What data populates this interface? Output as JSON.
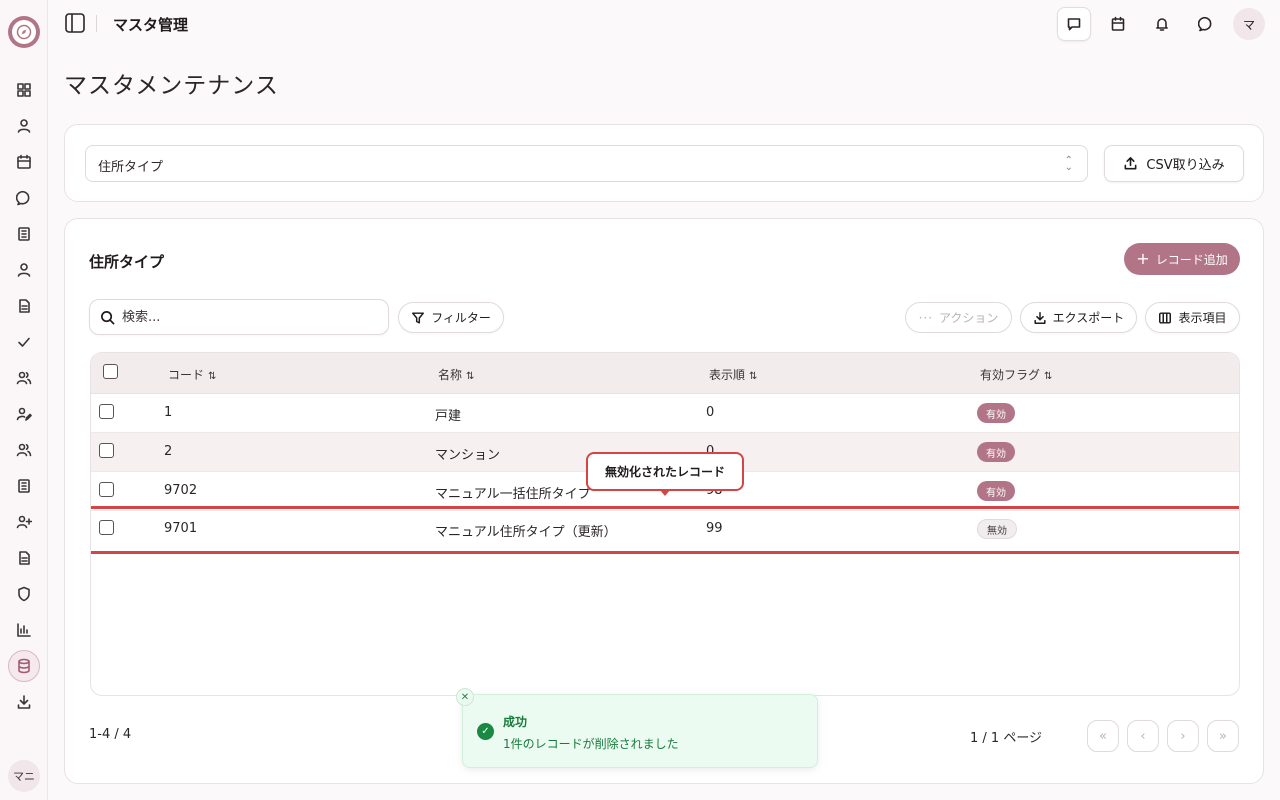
{
  "header": {
    "title": "マスタ管理",
    "avatar": "マ"
  },
  "sidebar": {
    "items": [
      "dashboard-icon",
      "user-icon",
      "calendar-icon",
      "chat-icon",
      "book-icon",
      "user-icon",
      "file-icon",
      "check-icon",
      "users-icon",
      "user-edit-icon",
      "users-icon",
      "book-icon",
      "user-plus-icon",
      "file-icon",
      "shield-icon",
      "chart-icon",
      "database-icon",
      "download-icon"
    ],
    "active": "database-icon",
    "avatar": "マニ"
  },
  "page": {
    "title": "マスタメンテナンス"
  },
  "master_select": {
    "value": "住所タイプ"
  },
  "csv_import_label": "CSV取り込み",
  "section": {
    "title": "住所タイプ",
    "add_label": "レコード追加"
  },
  "toolbar": {
    "search_placeholder": "検索...",
    "filter_label": "フィルター",
    "action_label": "アクション",
    "export_label": "エクスポート",
    "columns_label": "表示項目"
  },
  "table": {
    "columns": [
      "コード",
      "名称",
      "表示順",
      "有効フラグ"
    ],
    "sort_glyph": "⇅",
    "rows": [
      {
        "code": "1",
        "name": "戸建",
        "order": "0",
        "flag": "有効"
      },
      {
        "code": "2",
        "name": "マンション",
        "order": "0",
        "flag": "有効"
      },
      {
        "code": "9702",
        "name": "マニュアル一括住所タイプ",
        "order": "98",
        "flag": "有効"
      },
      {
        "code": "9701",
        "name": "マニュアル住所タイプ（更新）",
        "order": "99",
        "flag": "無効"
      }
    ]
  },
  "tooltip": {
    "text": "無効化されたレコード"
  },
  "pagination": {
    "count": "1-4 / 4",
    "page": "1 / 1 ページ"
  },
  "toast": {
    "title": "成功",
    "message": "1件のレコードが削除されました"
  },
  "colors": {
    "accent": "#b27588",
    "highlight": "#d64545",
    "success": "#1a8a43"
  }
}
